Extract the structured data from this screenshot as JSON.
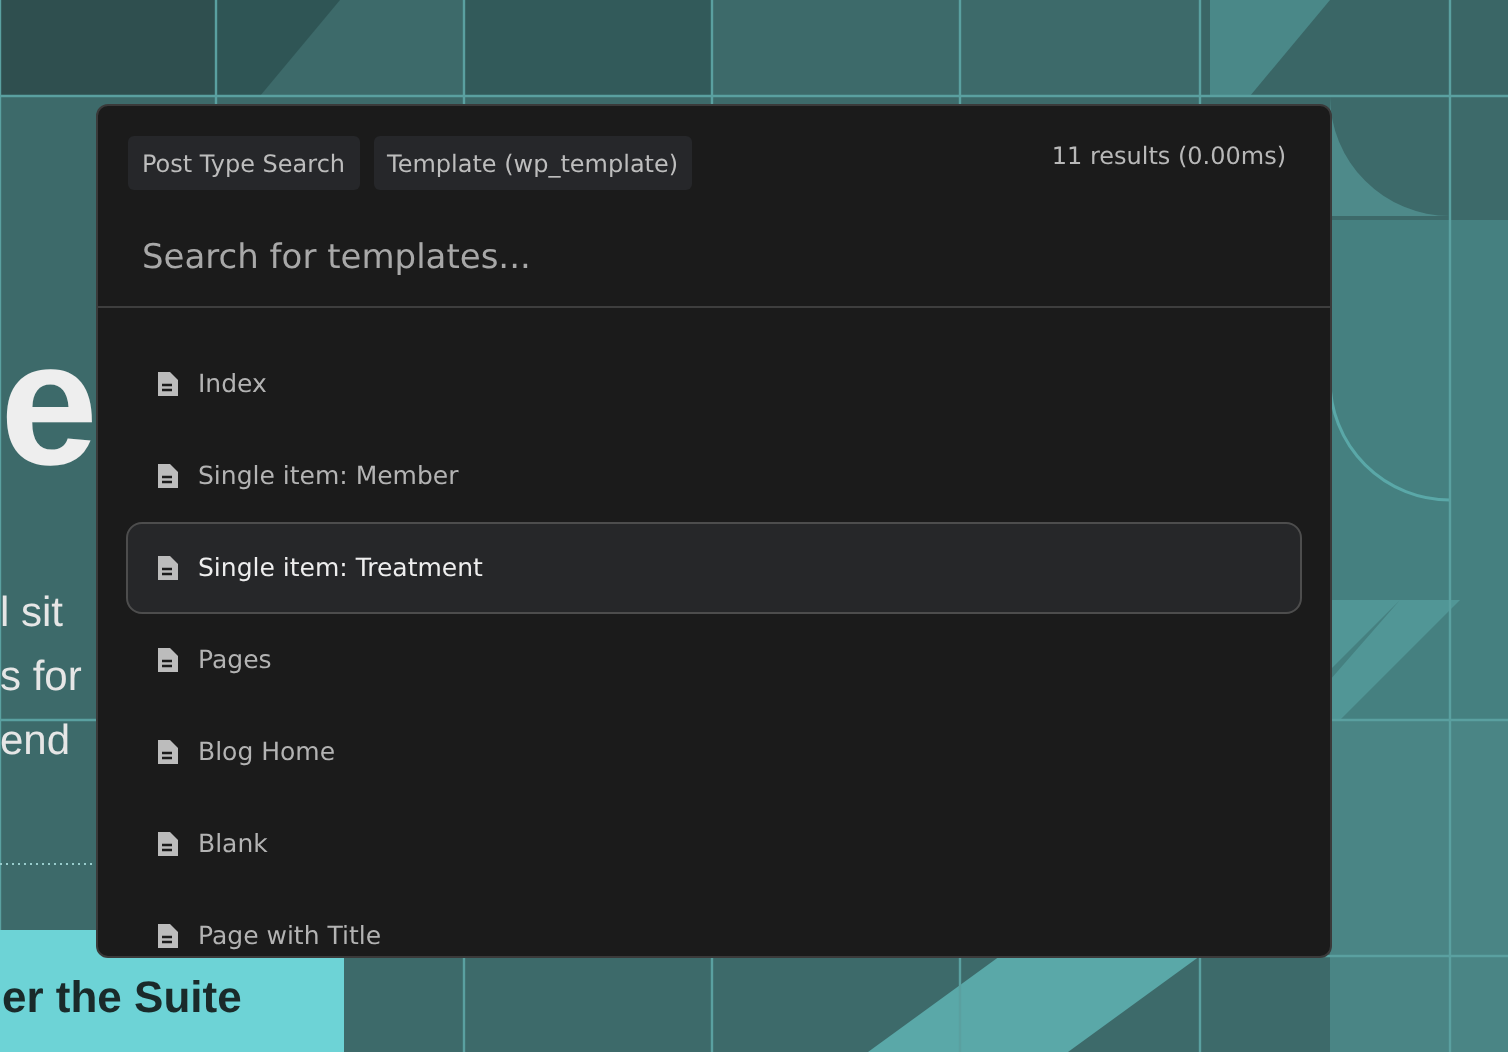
{
  "background_page": {
    "heading": "e",
    "paragraph_lines": [
      "l sit",
      "s for",
      "end"
    ],
    "button": "er the Suite"
  },
  "search_modal": {
    "filters": [
      "Post Type Search",
      "Template (wp_template)"
    ],
    "result_count": "11 results (0.00ms)",
    "search": {
      "placeholder": "Search for templates..."
    },
    "results": [
      {
        "label": "Index",
        "selected": false
      },
      {
        "label": "Single item: Member",
        "selected": false
      },
      {
        "label": "Single item: Treatment",
        "selected": true
      },
      {
        "label": "Pages",
        "selected": false
      },
      {
        "label": "Blog Home",
        "selected": false
      },
      {
        "label": "Blank",
        "selected": false
      },
      {
        "label": "Page with Title",
        "selected": false
      }
    ]
  }
}
